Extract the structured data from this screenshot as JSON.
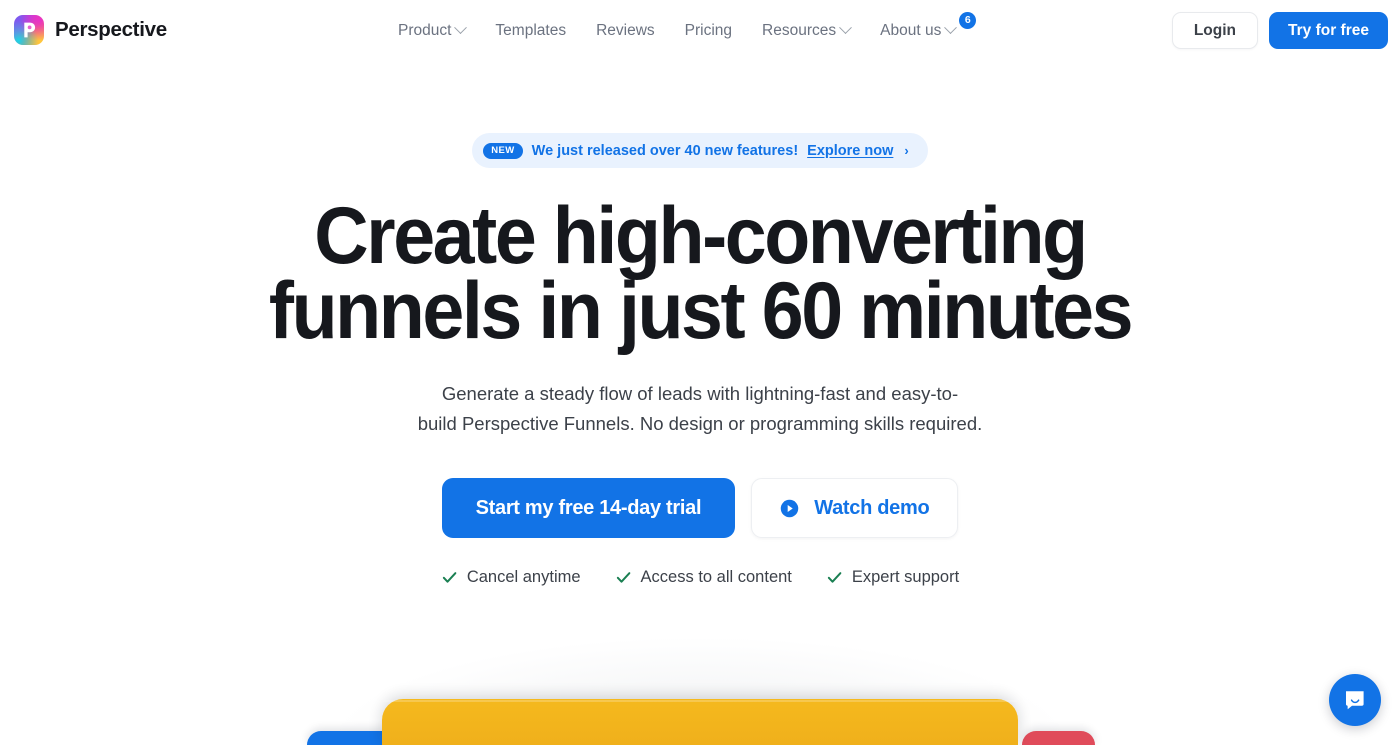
{
  "brand": {
    "name": "Perspective",
    "logo_icon": "perspective-logo-icon"
  },
  "nav": {
    "items": [
      {
        "label": "Product",
        "has_dropdown": true,
        "badge": null
      },
      {
        "label": "Templates",
        "has_dropdown": false,
        "badge": null
      },
      {
        "label": "Reviews",
        "has_dropdown": false,
        "badge": null
      },
      {
        "label": "Pricing",
        "has_dropdown": false,
        "badge": null
      },
      {
        "label": "Resources",
        "has_dropdown": true,
        "badge": null
      },
      {
        "label": "About us",
        "has_dropdown": true,
        "badge": "6"
      }
    ]
  },
  "header_actions": {
    "login_label": "Login",
    "try_label": "Try for free"
  },
  "announcement": {
    "badge": "NEW",
    "text": "We just released over 40 new features!",
    "link_label": "Explore now",
    "arrow": "›"
  },
  "hero": {
    "headline_line1": "Create high-converting",
    "headline_line2": "funnels in just 60 minutes",
    "subhead_line1": "Generate a steady flow of leads with lightning-fast and easy-to-",
    "subhead_line2": "build Perspective Funnels. No design or programming skills required.",
    "primary_cta": "Start my free 14-day trial",
    "secondary_cta": "Watch demo",
    "secondary_cta_icon": "play-circle-icon",
    "features": [
      {
        "icon": "check-icon",
        "label": "Cancel anytime"
      },
      {
        "icon": "check-icon",
        "label": "Access to all content"
      },
      {
        "icon": "check-icon",
        "label": "Expert support"
      }
    ]
  },
  "showcase": {
    "cards": [
      {
        "name": "blue-phone-card",
        "color": "#1273e6"
      },
      {
        "name": "yellow-phone-card",
        "color": "#f2b31c"
      },
      {
        "name": "red-phone-card",
        "color": "#e04b5a"
      }
    ]
  },
  "chat": {
    "icon": "chat-bubble-icon",
    "label": "Open chat"
  },
  "colors": {
    "brand_blue": "#1273e6",
    "banner_bg": "#e9f2fe",
    "text_dark": "#16181d",
    "text_muted": "#6b7280",
    "check_green": "#1a7f52",
    "yellow": "#f2b31c",
    "red": "#e04b5a"
  }
}
